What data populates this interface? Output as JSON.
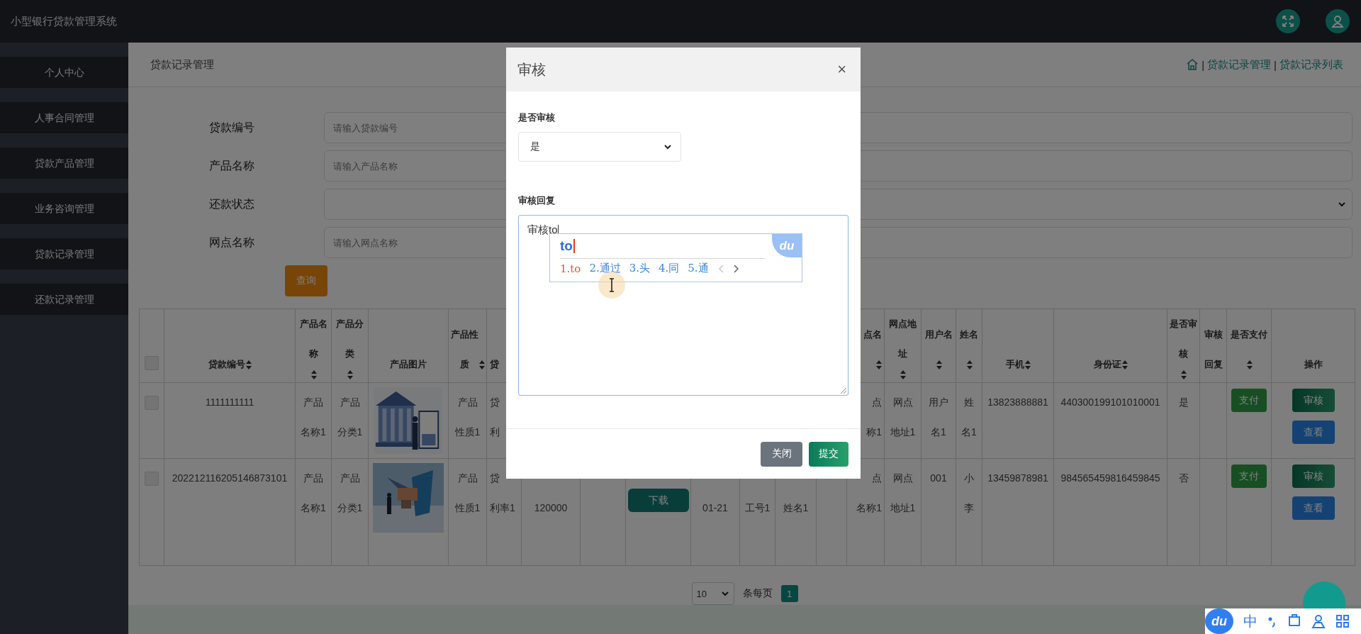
{
  "topbar": {
    "title": "小型银行贷款管理系统",
    "actions": [
      {
        "kind": "fullscreen"
      },
      {
        "kind": "user"
      }
    ]
  },
  "sidebar": {
    "items": [
      {
        "label": "个人中心"
      },
      {
        "label": "人事合同管理"
      },
      {
        "label": "贷款产品管理"
      },
      {
        "label": "业务咨询管理"
      },
      {
        "label": "贷款记录管理"
      },
      {
        "label": "还款记录管理"
      }
    ]
  },
  "page_header": {
    "title": "贷款记录管理",
    "breadcrumb": [
      {
        "kind": "home"
      },
      {
        "kind": "separator",
        "text": "|"
      },
      {
        "kind": "link",
        "text": "贷款记录管理"
      },
      {
        "kind": "separator",
        "text": "|"
      },
      {
        "kind": "link",
        "text": "贷款记录列表"
      }
    ]
  },
  "search_form": {
    "fields": [
      {
        "label": "贷款编号",
        "kind": "input",
        "placeholder": "请输入贷款编号"
      },
      {
        "label": "产品名称",
        "kind": "input",
        "placeholder": "请输入产品名称"
      },
      {
        "label": "还款状态",
        "kind": "select"
      },
      {
        "label": "网点名称",
        "kind": "input",
        "placeholder": "请输入网点名称"
      }
    ],
    "submit": "查询"
  },
  "table": {
    "columns": [
      {
        "kind": "check",
        "checked": false
      },
      {
        "lines": [
          "贷款编号"
        ],
        "sortable": true
      },
      {
        "lines": [
          "产品名",
          "称"
        ],
        "sortable": true
      },
      {
        "lines": [
          "产品分",
          "类"
        ],
        "sortable": true
      },
      {
        "lines": [
          "产品图片"
        ],
        "sortable": false
      },
      {
        "lines": [
          "产品性",
          "质"
        ],
        "sortable": true
      },
      {
        "lines": [
          "贷"
        ],
        "sortable": false
      },
      {},
      {},
      {},
      {},
      {},
      {},
      {},
      {
        "lines": [
          "点名"
        ],
        "sortable": true,
        "sort_below": true
      },
      {
        "lines": [
          "网点地",
          "址"
        ],
        "sortable": true
      },
      {
        "lines": [
          "用户名"
        ],
        "sortable": true,
        "sort_below": true
      },
      {
        "lines": [
          "姓名"
        ],
        "sortable": true,
        "sort_below": true
      },
      {
        "lines": [
          "手机"
        ],
        "sortable": true
      },
      {
        "lines": [
          "身份证"
        ],
        "sortable": true
      },
      {
        "lines": [
          "是否审",
          "核"
        ],
        "sortable": true
      },
      {
        "lines": [
          "审核",
          "回复"
        ],
        "sortable": false
      },
      {
        "lines": [
          "是否支付"
        ],
        "sortable": true,
        "sort_below": true
      },
      {
        "lines": [
          "操作"
        ],
        "sortable": false
      }
    ],
    "rows": [
      {
        "cells": [
          {
            "kind": "check",
            "checked": false
          },
          {
            "kind": "text",
            "lines": [
              "1111111111"
            ]
          },
          {
            "kind": "text",
            "lines": [
              "产品",
              "名称1"
            ]
          },
          {
            "kind": "text",
            "lines": [
              "产品",
              "分类1"
            ]
          },
          {
            "kind": "picture"
          },
          {
            "kind": "text",
            "lines": [
              "产品",
              "性质1"
            ]
          },
          {
            "kind": "text",
            "lines": [
              "贷",
              "利"
            ]
          },
          {},
          {},
          {},
          {},
          {},
          {},
          {},
          {
            "kind": "text",
            "lines": [
              "点",
              "称1"
            ]
          },
          {
            "kind": "text",
            "lines": [
              "网点",
              "地址1"
            ]
          },
          {
            "kind": "text",
            "lines": [
              "用户",
              "名1"
            ]
          },
          {
            "kind": "text",
            "lines": [
              "姓",
              "名1"
            ]
          },
          {
            "kind": "text",
            "lines": [
              "13823888881"
            ]
          },
          {
            "kind": "text",
            "lines": [
              "440300199101010001"
            ]
          },
          {
            "kind": "text",
            "lines": [
              "是"
            ]
          },
          {},
          {
            "kind": "buttons",
            "buttons": [
              {
                "label": "支付",
                "kind": "pay"
              }
            ]
          },
          {
            "kind": "buttons",
            "buttons": [
              {
                "label": "审核",
                "kind": "audit"
              },
              {
                "label": "查看",
                "kind": "view"
              }
            ]
          }
        ]
      },
      {
        "cells": [
          {
            "kind": "check",
            "checked": false
          },
          {
            "kind": "text",
            "lines": [
              "202212116205146873101"
            ]
          },
          {
            "kind": "text",
            "lines": [
              "产品",
              "名称1"
            ]
          },
          {
            "kind": "text",
            "lines": [
              "产品",
              "分类1"
            ]
          },
          {
            "kind": "picture"
          },
          {
            "kind": "text",
            "lines": [
              "产品",
              "性质1"
            ]
          },
          {
            "kind": "text",
            "lines": [
              "贷",
              "利率1"
            ]
          },
          {
            "kind": "text",
            "lower": true,
            "lines": [
              "120000"
            ]
          },
          {},
          {
            "kind": "buttons",
            "lower": true,
            "buttons": [
              {
                "label": "下载",
                "kind": "download"
              }
            ]
          },
          {
            "kind": "text",
            "lower": true,
            "lines": [
              "01-21"
            ]
          },
          {
            "kind": "text",
            "lower": true,
            "lines": [
              "工号1"
            ]
          },
          {
            "kind": "text",
            "lower": true,
            "lines": [
              "姓名1"
            ]
          },
          {},
          {
            "kind": "text",
            "lines": [
              "点",
              "名称1"
            ]
          },
          {
            "kind": "text",
            "lines": [
              "网点",
              "地址1"
            ]
          },
          {
            "kind": "text",
            "lines": [
              "001"
            ]
          },
          {
            "kind": "text",
            "lines": [
              "小",
              "李"
            ]
          },
          {
            "kind": "text",
            "lines": [
              "13459878981"
            ]
          },
          {
            "kind": "text",
            "lines": [
              "984565459816459845"
            ]
          },
          {
            "kind": "text",
            "lines": [
              "否"
            ]
          },
          {},
          {
            "kind": "buttons",
            "buttons": [
              {
                "label": "支付",
                "kind": "pay"
              }
            ]
          },
          {
            "kind": "buttons",
            "buttons": [
              {
                "label": "审核",
                "kind": "audit"
              },
              {
                "label": "查看",
                "kind": "view"
              }
            ]
          }
        ]
      }
    ]
  },
  "pagination": {
    "page_size": "10",
    "per_page_label": "条每页",
    "pages": [
      {
        "label": "1",
        "selected": true
      }
    ]
  },
  "modal": {
    "title": "审核",
    "close": "×",
    "fields": [
      {
        "label": "是否审核",
        "kind": "select",
        "value": "是"
      },
      {
        "label": "审核回复",
        "kind": "textarea",
        "value": "审核to"
      }
    ],
    "buttons": [
      {
        "label": "关闭",
        "kind": "secondary"
      },
      {
        "label": "提交",
        "kind": "primary"
      }
    ]
  },
  "ime_popup": {
    "composition": "to",
    "logo": "du",
    "candidates": [
      {
        "label": "1.to",
        "selected": true
      },
      {
        "label": "2.通过",
        "selected": false
      },
      {
        "label": "3.头",
        "selected": false
      },
      {
        "label": "4.同",
        "selected": false
      },
      {
        "label": "5.通",
        "selected": false
      }
    ]
  },
  "ime_toolbar": {
    "logo": "du",
    "mode": "中"
  }
}
